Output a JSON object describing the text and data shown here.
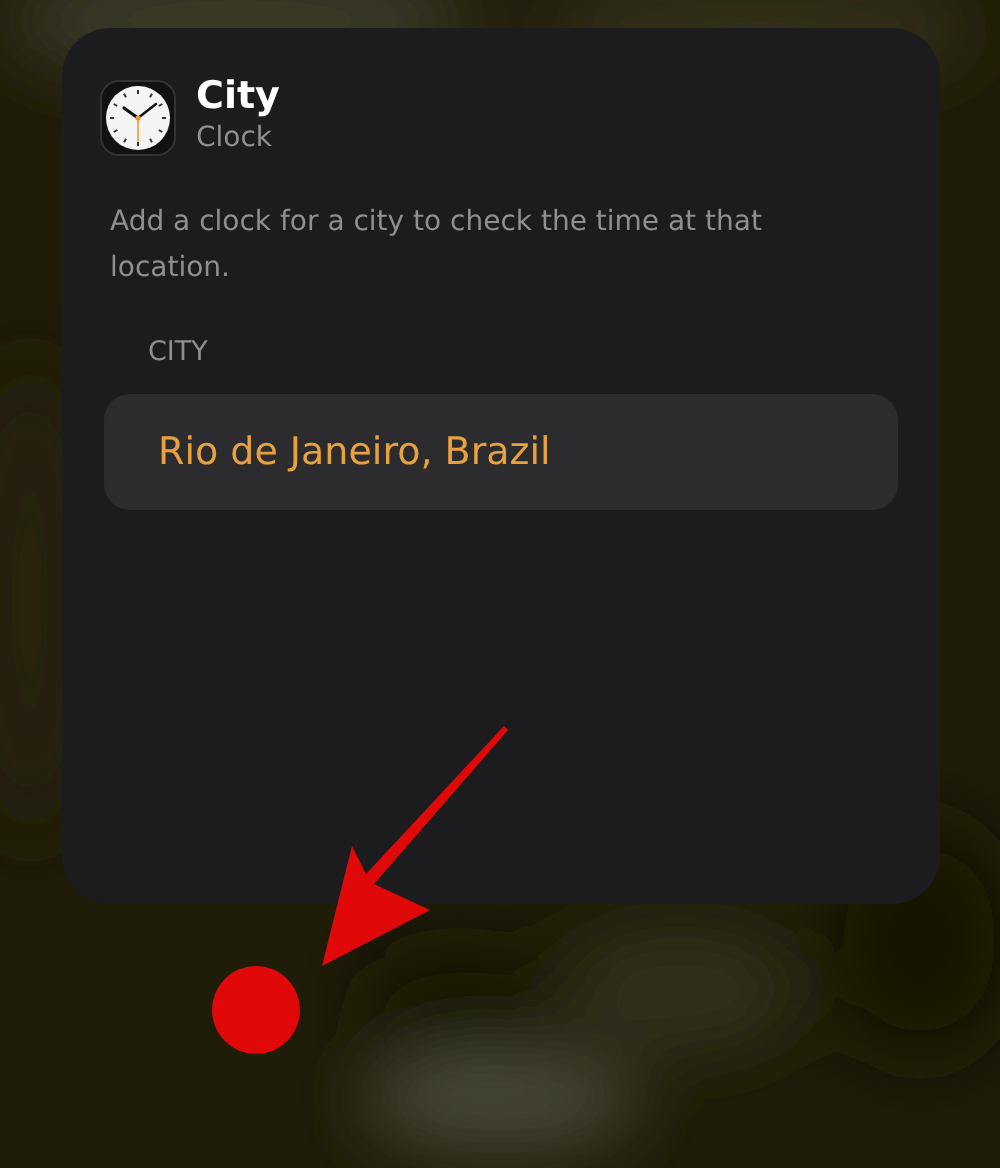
{
  "widget": {
    "title": "City",
    "app": "Clock",
    "description": "Add a clock for a city to check the time at that location.",
    "field_label": "CITY",
    "field_value": "Rio de Janeiro, Brazil"
  }
}
